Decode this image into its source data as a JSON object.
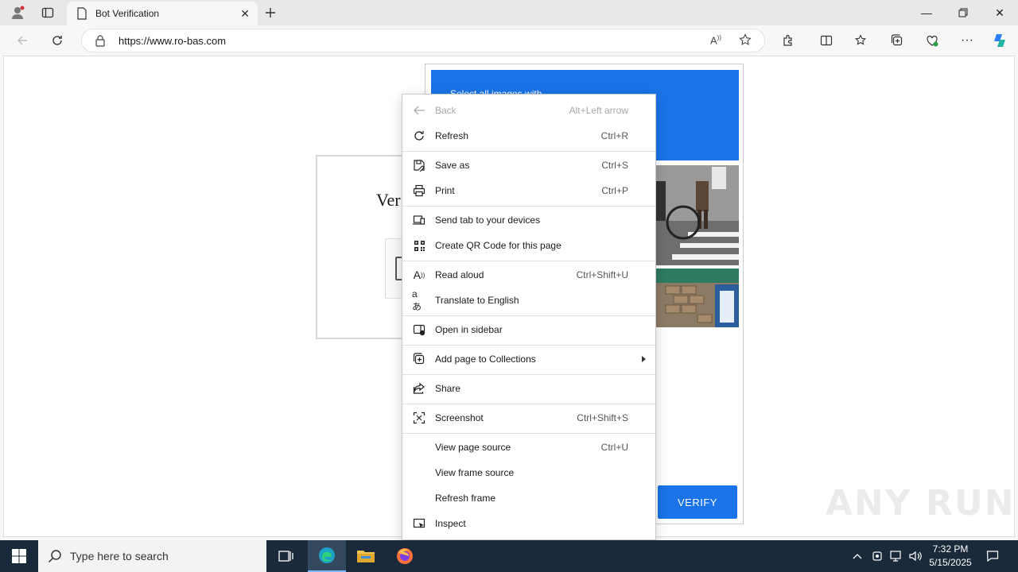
{
  "browser": {
    "tab_title": "Bot Verification",
    "url": "https://www.ro-bas.com"
  },
  "page": {
    "heading": "Ver",
    "challenge_text": "Select all images with",
    "verify_button": "VERIFY"
  },
  "context_menu": {
    "items": [
      {
        "label": "Back",
        "shortcut": "Alt+Left arrow",
        "icon": "back-arrow-icon",
        "disabled": true
      },
      {
        "label": "Refresh",
        "shortcut": "Ctrl+R",
        "icon": "refresh-icon"
      },
      {
        "label": "Save as",
        "shortcut": "Ctrl+S",
        "icon": "save-icon"
      },
      {
        "label": "Print",
        "shortcut": "Ctrl+P",
        "icon": "print-icon"
      },
      {
        "label": "Send tab to your devices",
        "shortcut": "",
        "icon": "send-device-icon"
      },
      {
        "label": "Create QR Code for this page",
        "shortcut": "",
        "icon": "qr-code-icon"
      },
      {
        "label": "Read aloud",
        "shortcut": "Ctrl+Shift+U",
        "icon": "read-aloud-icon"
      },
      {
        "label": "Translate to English",
        "shortcut": "",
        "icon": "translate-icon"
      },
      {
        "label": "Open in sidebar",
        "shortcut": "",
        "icon": "sidebar-icon"
      },
      {
        "label": "Add page to Collections",
        "shortcut": "",
        "icon": "collections-icon",
        "submenu": true
      },
      {
        "label": "Share",
        "shortcut": "",
        "icon": "share-icon"
      },
      {
        "label": "Screenshot",
        "shortcut": "Ctrl+Shift+S",
        "icon": "screenshot-icon"
      },
      {
        "label": "View page source",
        "shortcut": "Ctrl+U",
        "icon": ""
      },
      {
        "label": "View frame source",
        "shortcut": "",
        "icon": ""
      },
      {
        "label": "Refresh frame",
        "shortcut": "",
        "icon": ""
      },
      {
        "label": "Inspect",
        "shortcut": "",
        "icon": "inspect-icon"
      }
    ]
  },
  "taskbar": {
    "search_placeholder": "Type here to search",
    "time": "7:32 PM",
    "date": "5/15/2025"
  },
  "watermark": "ANY RUN",
  "colors": {
    "accent": "#1a73e8",
    "taskbar": "#1b2a3a"
  }
}
